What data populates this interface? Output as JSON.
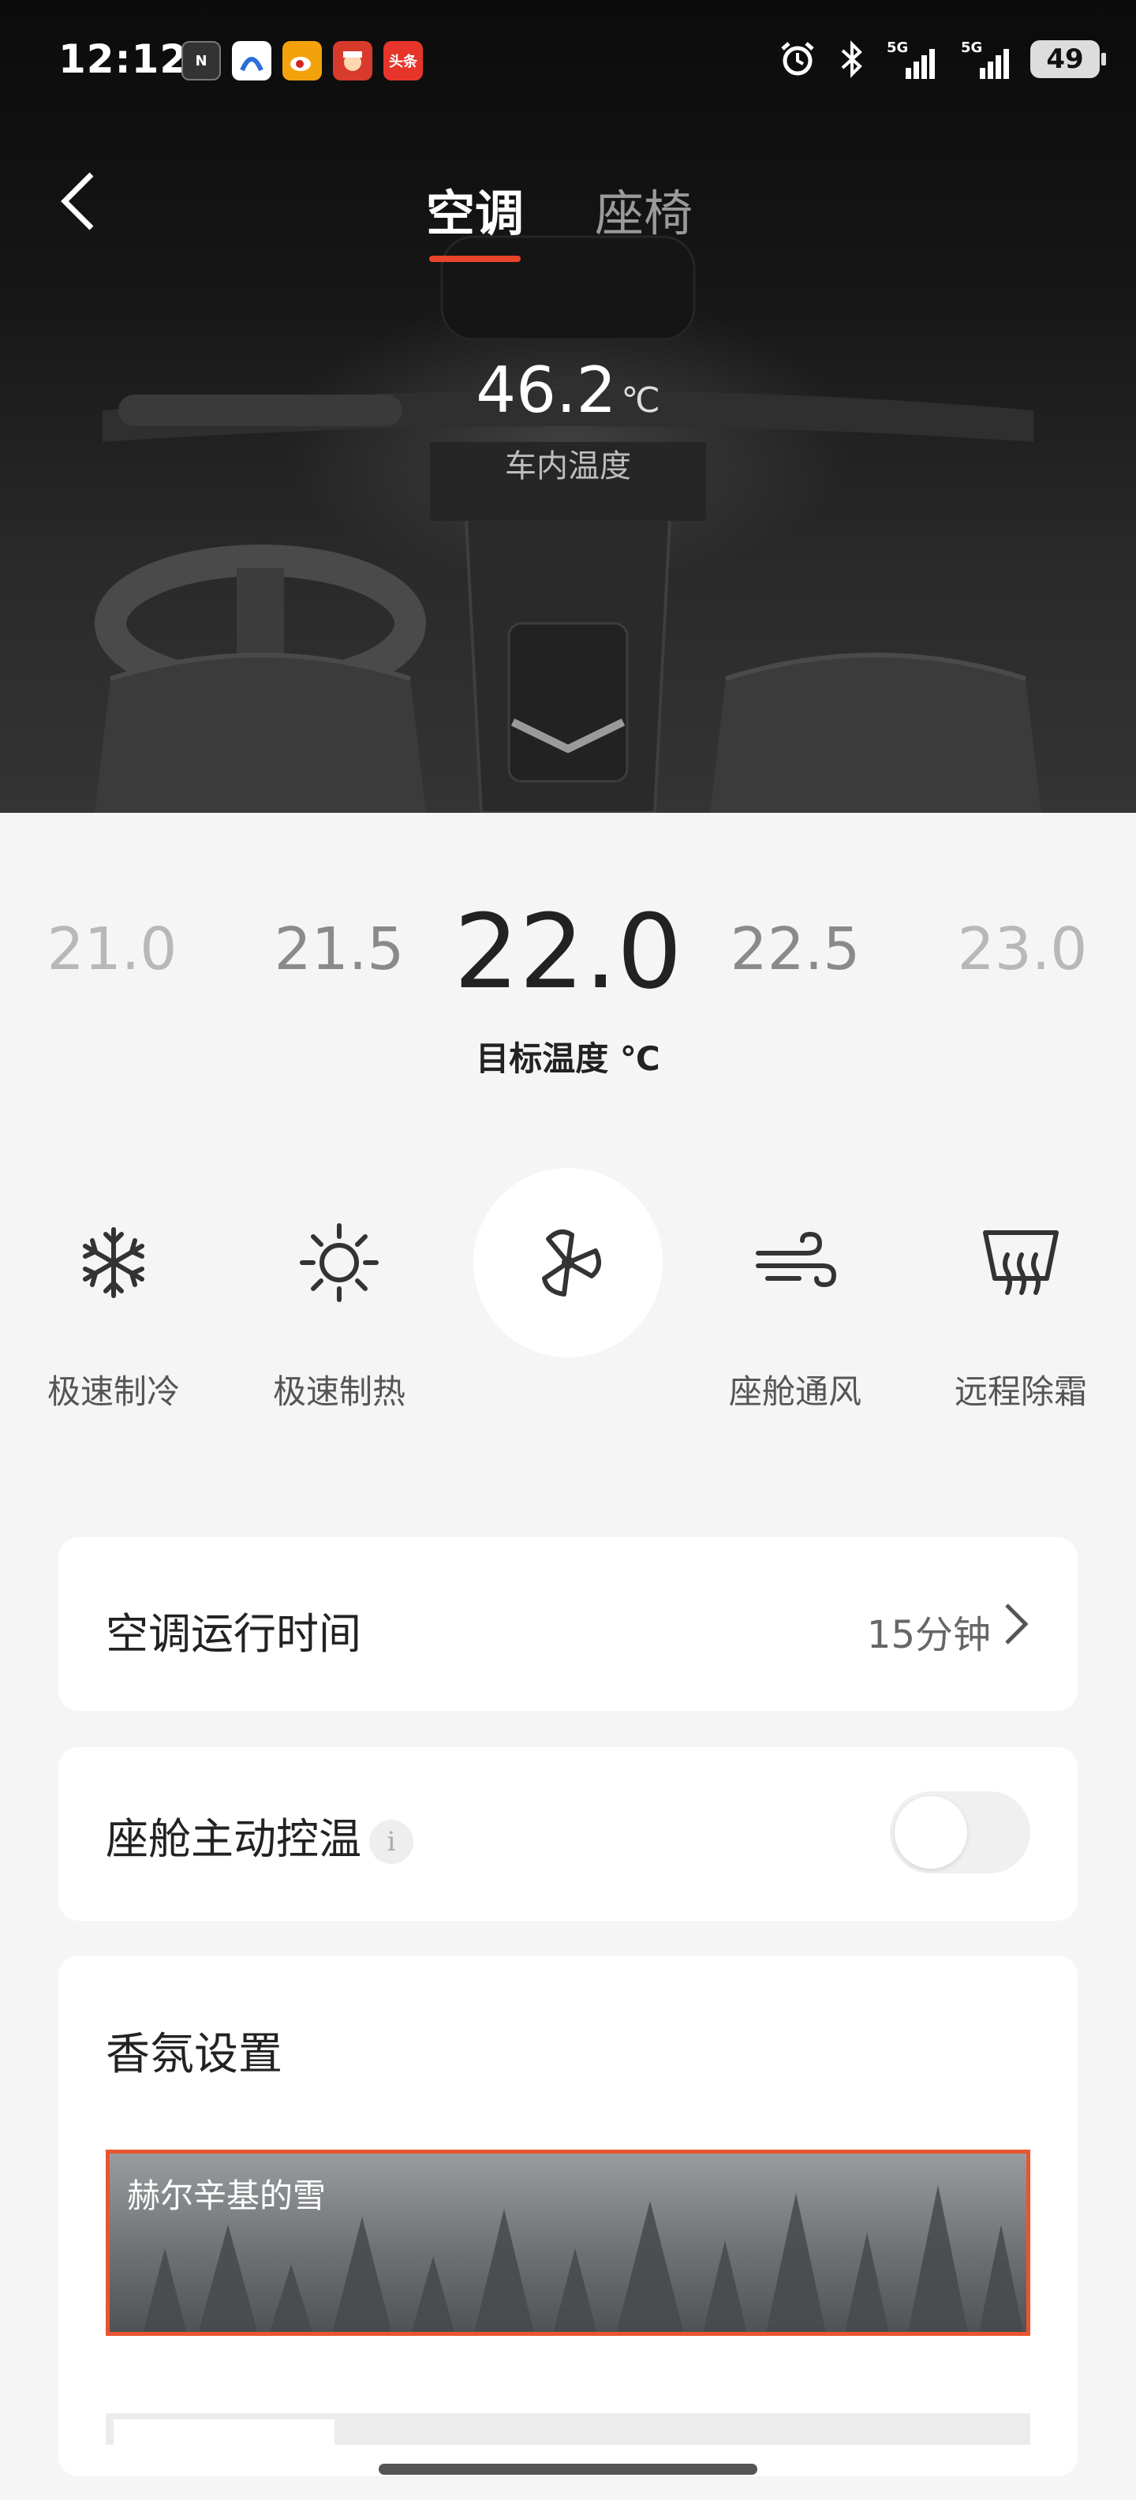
{
  "status_bar": {
    "time": "12:12",
    "notifications": [
      {
        "name": "app-notification-icon",
        "text": "N",
        "color": "#333333"
      },
      {
        "name": "map-app-icon",
        "text": "",
        "color": "#2a6fd6"
      },
      {
        "name": "weibo-icon",
        "text": "",
        "color": "#f4a20c"
      },
      {
        "name": "game-app-icon",
        "text": "",
        "color": "#d83a2c"
      },
      {
        "name": "toutiao-icon",
        "text": "头条",
        "color": "#e8352b"
      }
    ],
    "signal_labels": [
      "5G",
      "5G"
    ],
    "battery": "49"
  },
  "header": {
    "tabs": [
      {
        "label": "空调",
        "active": true
      },
      {
        "label": "座椅",
        "active": false
      }
    ]
  },
  "cabin": {
    "temperature": "46.2",
    "unit": "℃",
    "label": "车内温度"
  },
  "target_temp": {
    "options": [
      "21.0",
      "21.5",
      "22.0",
      "22.5",
      "23.0"
    ],
    "selected": "22.0",
    "caption": "目标温度 ℃"
  },
  "modes": [
    {
      "icon": "snowflake-icon",
      "label": "极速制冷",
      "active": false
    },
    {
      "icon": "sun-icon",
      "label": "极速制热",
      "active": false
    },
    {
      "icon": "fan-icon",
      "label": "",
      "active": true
    },
    {
      "icon": "wind-icon",
      "label": "座舱通风",
      "active": false
    },
    {
      "icon": "defrost-icon",
      "label": "远程除霜",
      "active": false
    }
  ],
  "runtime": {
    "label": "空调运行时间",
    "value": "15分钟"
  },
  "active_temp_control": {
    "label": "座舱主动控温",
    "info_glyph": "i",
    "enabled": false
  },
  "aroma": {
    "title": "香氛设置",
    "selected_scent": "赫尔辛基的雪"
  },
  "colors": {
    "accent": "#e8442c",
    "selection_border": "#e8552f"
  }
}
